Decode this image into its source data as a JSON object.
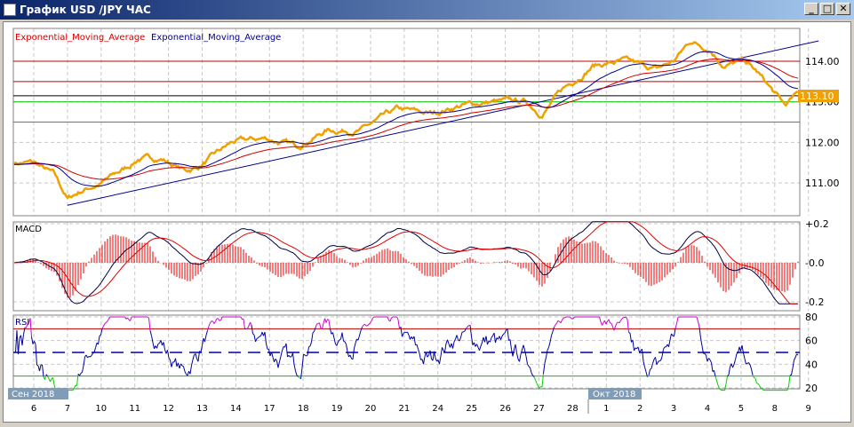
{
  "window": {
    "title": "График USD /JPY  ЧАС",
    "minimize": "_",
    "maximize": "□",
    "close": "✕"
  },
  "legend": {
    "ema_red": "Exponential_Moving_Average",
    "ema_blue": "Exponential_Moving_Average"
  },
  "colors": {
    "price": "#f0a000",
    "ema_red": "#d00000",
    "ema_blue": "#00008b",
    "trend": "#00008b",
    "overbought": "#c00000",
    "oversold": "#00c000",
    "rsi": "#0000a0",
    "rsi_high": "#d000d0",
    "rsi_low": "#00d000"
  },
  "panels": {
    "macd_label": "MACD",
    "rsi_label": "RSI"
  },
  "months": {
    "sep": "Сен 2018",
    "oct": "Окт 2018"
  },
  "current_price": "113.10",
  "chart_data": [
    {
      "type": "line",
      "title": "USD/JPY",
      "y_ticks": [
        "114.00",
        "113.00",
        "112.00",
        "111.00"
      ],
      "ylim": [
        110.3,
        114.8
      ],
      "x_labels": [
        "6",
        "7",
        "10",
        "11",
        "12",
        "13",
        "14",
        "17",
        "18",
        "19",
        "20",
        "21",
        "24",
        "25",
        "26",
        "27",
        "28",
        "1",
        "2",
        "3",
        "4",
        "5",
        "8",
        "9"
      ],
      "horizontal_levels": [
        {
          "value": 114.0,
          "color": "red"
        },
        {
          "value": 113.5,
          "color": "red"
        },
        {
          "value": 113.15,
          "color": "black"
        },
        {
          "value": 113.0,
          "color": "green"
        },
        {
          "value": 112.5,
          "color": "green"
        }
      ],
      "trendline": [
        [
          1.0,
          110.45
        ],
        [
          23.3,
          114.5
        ]
      ],
      "series_keypoints": [
        [
          -0.6,
          111.5
        ],
        [
          0,
          111.5
        ],
        [
          0.6,
          111.2
        ],
        [
          1,
          110.6
        ],
        [
          1.4,
          110.8
        ],
        [
          2,
          111.0
        ],
        [
          2.8,
          111.4
        ],
        [
          3.1,
          111.6
        ],
        [
          3.8,
          111.6
        ],
        [
          4.5,
          111.3
        ],
        [
          4.9,
          111.4
        ],
        [
          5.9,
          112.0
        ],
        [
          6.9,
          112.1
        ],
        [
          7.8,
          111.9
        ],
        [
          8.7,
          112.3
        ],
        [
          9.7,
          112.3
        ],
        [
          10.8,
          112.8
        ],
        [
          11.8,
          112.7
        ],
        [
          12.6,
          112.9
        ],
        [
          13.6,
          113.0
        ],
        [
          14.6,
          113.0
        ],
        [
          15.1,
          112.7
        ],
        [
          15.7,
          113.3
        ],
        [
          16.6,
          113.9
        ],
        [
          17.5,
          114.0
        ],
        [
          18.5,
          113.8
        ],
        [
          19,
          114.0
        ],
        [
          19.5,
          114.5
        ],
        [
          20.1,
          114.3
        ],
        [
          20.5,
          113.9
        ],
        [
          21.1,
          114.0
        ],
        [
          21.5,
          113.7
        ],
        [
          21.9,
          113.3
        ],
        [
          22.3,
          112.9
        ],
        [
          22.7,
          113.2
        ],
        [
          23.3,
          113.1
        ]
      ]
    },
    {
      "type": "line",
      "title": "MACD",
      "y_ticks": [
        "+0.2",
        "-0.0",
        "-0.2"
      ],
      "ylim": [
        -0.22,
        0.22
      ]
    },
    {
      "type": "line",
      "title": "RSI",
      "y_ticks": [
        "80",
        "60",
        "40",
        "20"
      ],
      "ylim": [
        20,
        80
      ],
      "levels": [
        70,
        50,
        30
      ]
    }
  ]
}
